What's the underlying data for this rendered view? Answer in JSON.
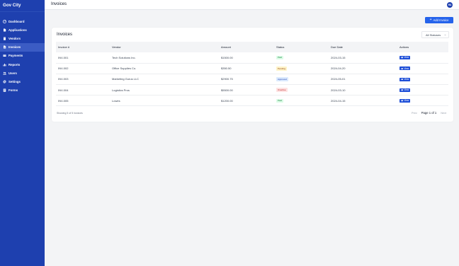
{
  "app": {
    "brand": "Gov City"
  },
  "sidebar": {
    "items": [
      {
        "label": "Dashboard",
        "icon": "dashboard-icon"
      },
      {
        "label": "Applications",
        "icon": "document-icon"
      },
      {
        "label": "Vendors",
        "icon": "building-icon"
      },
      {
        "label": "Invoices",
        "icon": "invoice-icon",
        "active": true
      },
      {
        "label": "Payments",
        "icon": "credit-card-icon"
      },
      {
        "label": "Reports",
        "icon": "chart-icon"
      },
      {
        "label": "Users",
        "icon": "users-icon"
      },
      {
        "label": "Settings",
        "icon": "gear-icon"
      },
      {
        "label": "Forms",
        "icon": "forms-icon"
      }
    ]
  },
  "header": {
    "title": "Invoices",
    "avatar_initials": "HA"
  },
  "toolbar": {
    "add_label": "Add Invoice"
  },
  "card": {
    "title": "Invoices",
    "filter_value": "All Statuses"
  },
  "table": {
    "columns": [
      "Invoice #",
      "Vendor",
      "Amount",
      "Status",
      "Due Date",
      "Actions"
    ],
    "rows": [
      {
        "invoice": "INV-001",
        "vendor": "Tech Solutions Inc.",
        "amount": "$1500.00",
        "status": "Paid",
        "status_key": "paid",
        "due": "2024-03-15",
        "action": "View"
      },
      {
        "invoice": "INV-002",
        "vendor": "Office Supplies Co.",
        "amount": "$350.50",
        "status": "Pending",
        "status_key": "pending",
        "due": "2024-04-20",
        "action": "View"
      },
      {
        "invoice": "INV-003",
        "vendor": "Marketing Gurus LLC",
        "amount": "$2900.75",
        "status": "Approved",
        "status_key": "approved",
        "due": "2024-05-01",
        "action": "View"
      },
      {
        "invoice": "INV-004",
        "vendor": "Logistics Pros",
        "amount": "$5500.00",
        "status": "Overdue",
        "status_key": "overdue",
        "due": "2024-03-10",
        "action": "View"
      },
      {
        "invoice": "INV-005",
        "vendor": "Lowes",
        "amount": "$1200.00",
        "status": "Paid",
        "status_key": "paid",
        "due": "2024-04-15",
        "action": "View"
      }
    ]
  },
  "footer": {
    "showing": "Showing 5 of 5 invoices",
    "prev": "Prev",
    "page": "Page 1 of 1",
    "next": "Next"
  },
  "colors": {
    "sidebar": "#1e40af",
    "accent": "#2563eb",
    "paid": "#dcfce7",
    "pending": "#fef3c7",
    "approved": "#dbeafe",
    "overdue": "#fee2e2"
  }
}
